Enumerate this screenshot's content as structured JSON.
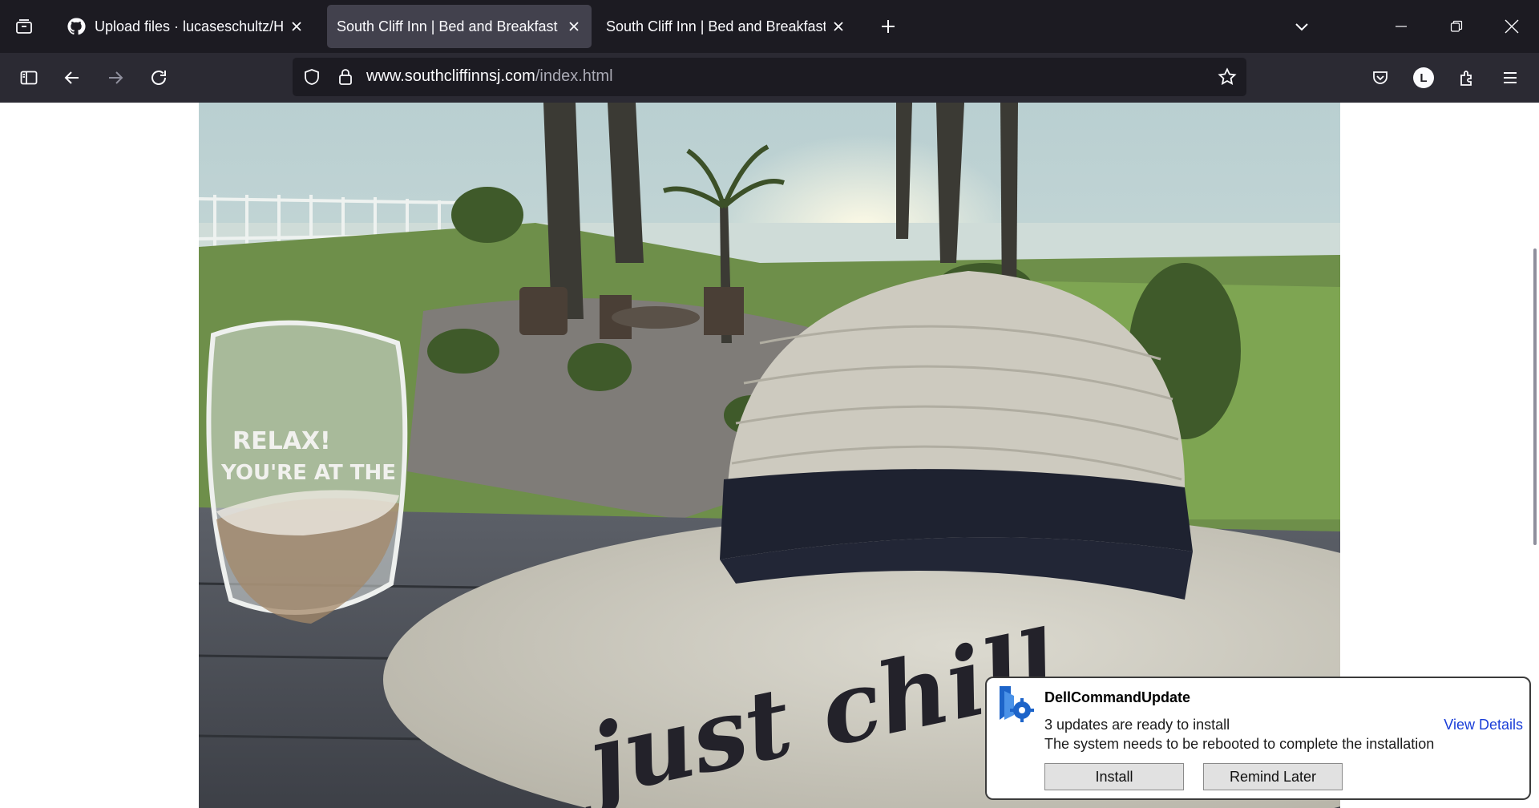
{
  "browser": {
    "tabs": [
      {
        "title": "Upload files · lucaseschultz/HTML",
        "active": false,
        "favicon": "github-icon"
      },
      {
        "title": "South Cliff Inn | Bed and Breakfast | Cape May, NJ",
        "active": true
      },
      {
        "title": "South Cliff Inn | Bed and Breakfast | Cape May, NJ",
        "active": false
      }
    ],
    "url": {
      "domain": "www.southcliffinnsj.com",
      "path": "/index.html"
    },
    "profile_initial": "L"
  },
  "page": {
    "image": {
      "glass_text_line1": "RELAX!",
      "glass_text_line2": "YOU'RE AT THE",
      "hat_text": "just chill"
    }
  },
  "notification": {
    "app_name": "DellCommandUpdate",
    "message_line1": "3 updates are ready to install",
    "message_line2": "The system needs to be rebooted to complete the installation",
    "details_link": "View Details",
    "install_label": "Install",
    "remind_label": "Remind Later"
  },
  "colors": {
    "tabstrip": "#1c1b22",
    "navbar": "#2b2a33",
    "active_tab": "#42414d",
    "link": "#1a3ed8"
  }
}
